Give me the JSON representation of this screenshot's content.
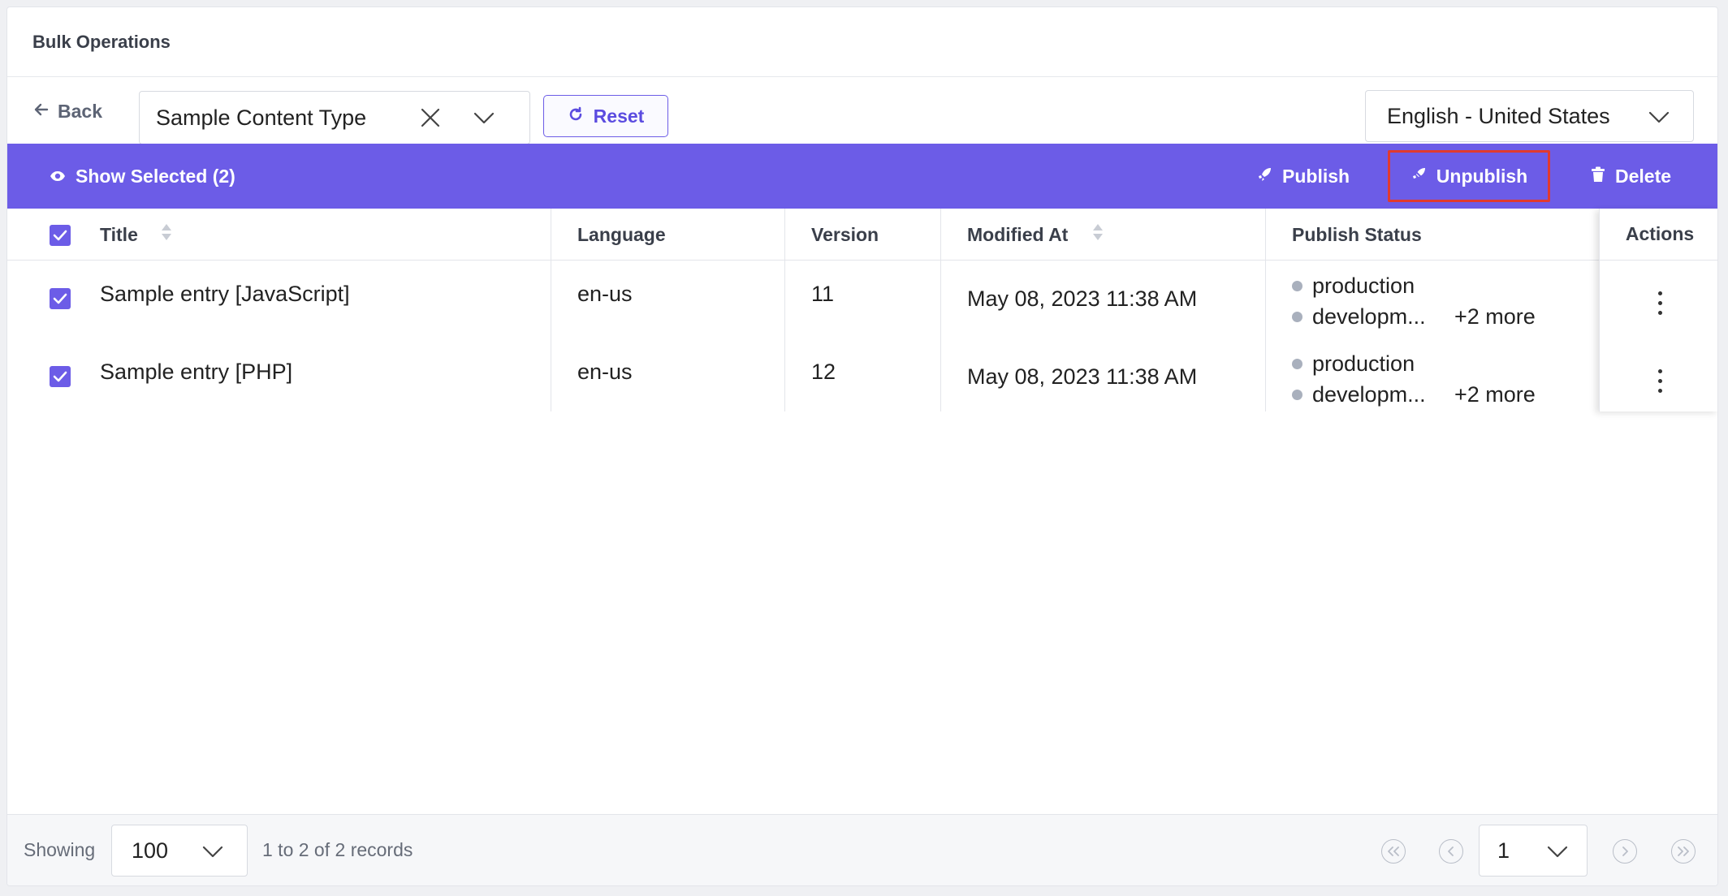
{
  "header": {
    "title": "Bulk Operations"
  },
  "toolbar": {
    "back_label": "Back",
    "content_type_value": "Sample Content Type",
    "reset_label": "Reset",
    "language_value": "English - United States"
  },
  "action_bar": {
    "show_selected_label": "Show Selected (2)",
    "publish_label": "Publish",
    "unpublish_label": "Unpublish",
    "delete_label": "Delete"
  },
  "table": {
    "columns": [
      "Title",
      "Language",
      "Version",
      "Modified At",
      "Publish Status",
      "Actions"
    ],
    "rows": [
      {
        "title": "Sample entry [JavaScript]",
        "language": "en-us",
        "version": "11",
        "modified_at": "May 08, 2023 11:38 AM",
        "status": [
          "production",
          "developm..."
        ],
        "more": "+2 more"
      },
      {
        "title": "Sample entry [PHP]",
        "language": "en-us",
        "version": "12",
        "modified_at": "May 08, 2023 11:38 AM",
        "status": [
          "production",
          "developm..."
        ],
        "more": "+2 more"
      }
    ]
  },
  "footer": {
    "showing_label": "Showing",
    "page_size": "100",
    "records_text": "1 to 2 of 2 records",
    "page_number": "1"
  },
  "colors": {
    "accent": "#6c5ce7",
    "highlight_border": "#e03a2f"
  }
}
